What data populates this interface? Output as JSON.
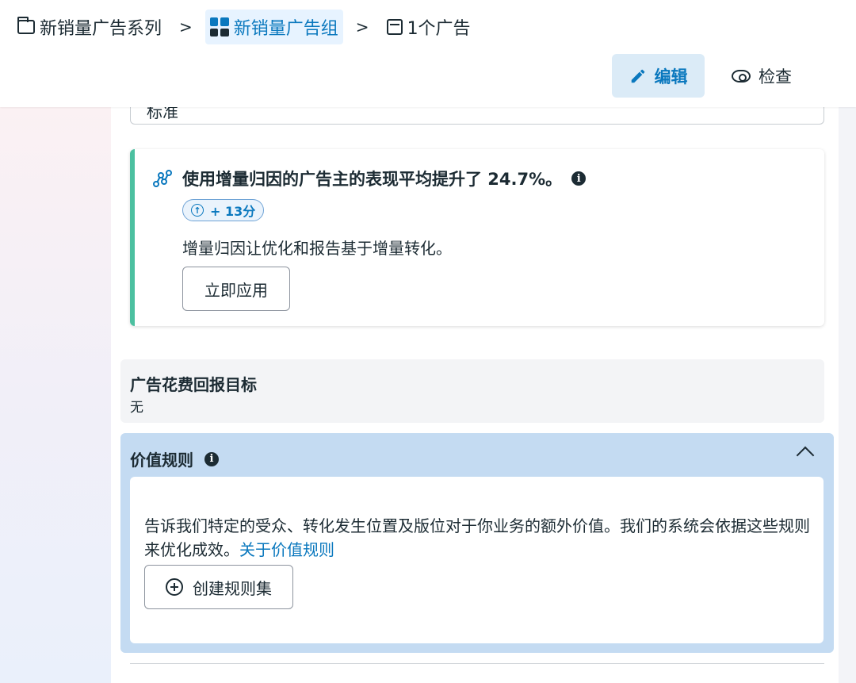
{
  "breadcrumb": {
    "campaign": "新销量广告系列",
    "adset": "新销量广告组",
    "ad": "1个广告",
    "separator": ">"
  },
  "toolbar": {
    "edit_label": "编辑",
    "inspect_label": "检查"
  },
  "select_field": {
    "value": "标准"
  },
  "recommendation": {
    "title": "使用增量归因的广告主的表现平均提升了 24.7%。",
    "badge": "+ 13分",
    "description": "增量归因让优化和报告基于增量转化。",
    "apply_label": "立即应用",
    "accent_color": "#4cc0a0"
  },
  "roas": {
    "title": "广告花费回报目标",
    "value": "无"
  },
  "value_rules": {
    "title": "价值规则",
    "description": "告诉我们特定的受众、转化发生位置及版位对于你业务的额外价值。我们的系统会依据这些规则来优化成效。",
    "link": "关于价值规则",
    "create_label": "创建规则集"
  },
  "colors": {
    "brand_blue": "#0a78be",
    "panel_blue": "#c4dbf2"
  }
}
